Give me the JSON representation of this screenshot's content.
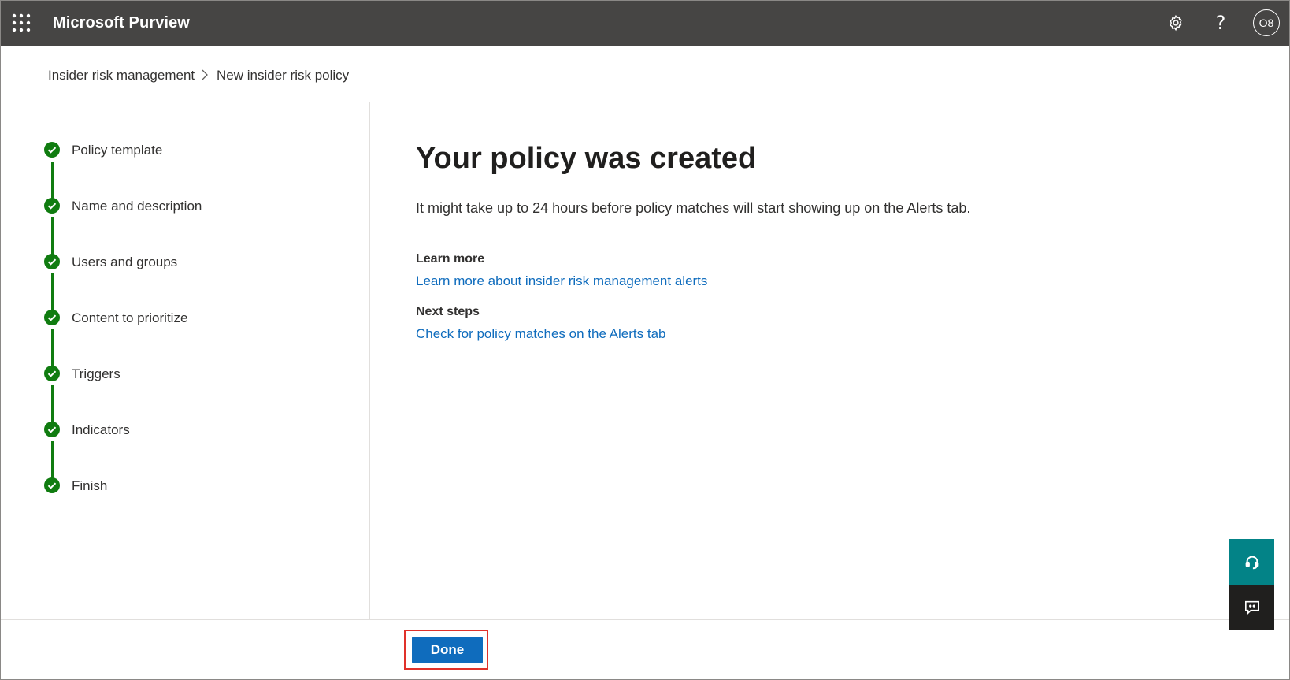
{
  "header": {
    "app_title": "Microsoft Purview",
    "avatar_initials": "O8",
    "help_glyph": "?",
    "icons": [
      "app-launcher-icon",
      "gear-icon",
      "help-icon"
    ]
  },
  "breadcrumb": {
    "items": [
      "Insider risk management",
      "New insider risk policy"
    ],
    "separator_icon": "chevron-right-icon"
  },
  "steps": {
    "status_icon": "check-circle-icon",
    "items": [
      {
        "label": "Policy template",
        "status": "complete"
      },
      {
        "label": "Name and description",
        "status": "complete"
      },
      {
        "label": "Users and groups",
        "status": "complete"
      },
      {
        "label": "Content to prioritize",
        "status": "complete"
      },
      {
        "label": "Triggers",
        "status": "complete"
      },
      {
        "label": "Indicators",
        "status": "complete"
      },
      {
        "label": "Finish",
        "status": "complete"
      }
    ]
  },
  "main": {
    "title": "Your policy was created",
    "description": "It might take up to 24 hours before policy matches will start showing up on the Alerts tab.",
    "learn_more_heading": "Learn more",
    "learn_more_link": "Learn more about insider risk management alerts",
    "next_steps_heading": "Next steps",
    "next_steps_link": "Check for policy matches on the Alerts tab"
  },
  "footer": {
    "done_label": "Done"
  },
  "side_actions": [
    "headset-icon",
    "feedback-icon"
  ],
  "colors": {
    "header_bg": "#464544",
    "accent": "#0f6cbd",
    "success": "#107c10",
    "highlight": "#e0312a",
    "support_bg": "#038387"
  }
}
